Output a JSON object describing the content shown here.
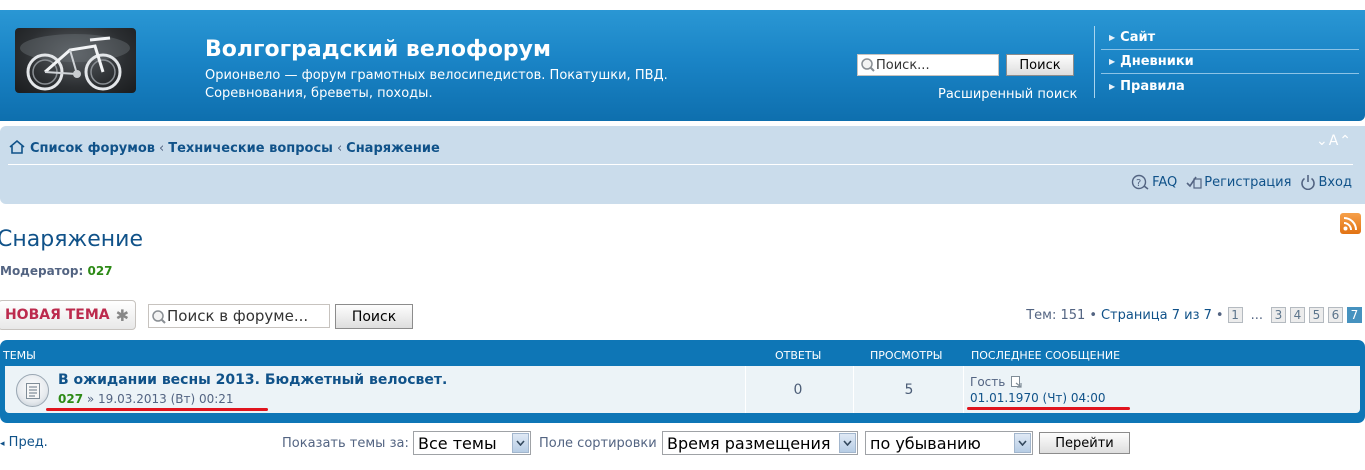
{
  "header": {
    "site_title": "Волгоградский велофорум",
    "site_desc": "Орионвело — форум грамотных велосипедистов. Покатушки, ПВД. Соревнования, бреветы, походы.",
    "search_placeholder": "Поиск...",
    "search_button": "Поиск",
    "advanced_search": "Расширенный поиск",
    "nav_links": [
      "Сайт",
      "Дневники",
      "Правила"
    ]
  },
  "navbar": {
    "breadcrumb": [
      "Список форумов",
      "Технические вопросы",
      "Снаряжение"
    ],
    "breadcrumb_sep": "‹",
    "fontsize": "⌄A⌃",
    "user_links": {
      "faq": "FAQ",
      "register": "Регистрация",
      "login": "Вход"
    }
  },
  "forum": {
    "title": "Снаряжение",
    "moderator_label": "Модератор:",
    "moderator": "027",
    "new_topic": "НОВАЯ ТЕМА",
    "new_topic_star": "✱",
    "search_placeholder": "Поиск в форуме...",
    "search_button": "Поиск"
  },
  "pagination": {
    "topics_label": "Тем: 151",
    "bullet": "•",
    "page_label": "Страница 7 из 7",
    "pages_before": [
      "1"
    ],
    "dots": "...",
    "pages_after": [
      "3",
      "4",
      "5",
      "6"
    ],
    "current": "7"
  },
  "table": {
    "headers": {
      "topics": "ТЕМЫ",
      "replies": "ОТВЕТЫ",
      "views": "ПРОСМОТРЫ",
      "last_post": "ПОСЛЕДНЕЕ СООБЩЕНИЕ"
    },
    "rows": [
      {
        "title": "В ожидании весны 2013. Бюджетный велосвет.",
        "author": "027",
        "date": "» 19.03.2013 (Вт) 00:21",
        "replies": "0",
        "views": "5",
        "last_author": "Гость",
        "last_time": "01.01.1970 (Чт) 04:00"
      }
    ]
  },
  "footer": {
    "prev": "Пред.",
    "show_topics_label": "Показать темы за:",
    "show_topics_value": "Все темы",
    "sort_label": "Поле сортировки",
    "sort_value": "Время размещения",
    "order_value": "по убыванию",
    "go_button": "Перейти"
  },
  "colors": {
    "header_blue": "#1a84c6",
    "navbar_bg": "#cadceb",
    "link": "#105289",
    "moderator_green": "#2d8a16",
    "new_topic_red": "#bc2a4d",
    "underline_red": "#e0141e"
  }
}
